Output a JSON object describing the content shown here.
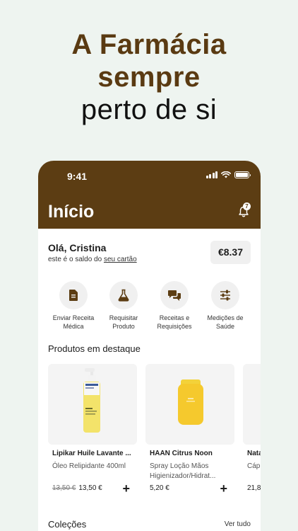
{
  "headline": {
    "line1": "A Farmácia",
    "line2": "sempre",
    "line3": "perto de si"
  },
  "status_bar": {
    "time": "9:41"
  },
  "header": {
    "title": "Início",
    "notification_count": "7"
  },
  "greeting": {
    "hello": "Olá, Cristina",
    "balance_prefix": "este é o saldo do ",
    "balance_link": "seu cartão",
    "balance": "€8.37"
  },
  "actions": [
    {
      "label": "Enviar Receita Médica",
      "icon": "document-icon"
    },
    {
      "label": "Requisitar Produto",
      "icon": "flask-icon"
    },
    {
      "label": "Receitas e Requisições",
      "icon": "chat-icon"
    },
    {
      "label": "Medições de Saúde",
      "icon": "sliders-icon"
    }
  ],
  "featured": {
    "title": "Produtos em destaque",
    "products": [
      {
        "name": "Lipikar Huile Lavante ...",
        "desc": "Óleo Relipidante 400ml",
        "old_price": "13,50 €",
        "price": "13,50 €"
      },
      {
        "name": "HAAN Citrus Noon",
        "desc": "Spray Loção Mãos Higienizador/Hidrat...",
        "old_price": "",
        "price": "5,20 €"
      },
      {
        "name": "Nata",
        "desc": "Cáp",
        "old_price": "",
        "price": "21,8"
      }
    ]
  },
  "collections": {
    "title": "Coleções",
    "see_all": "Ver tudo"
  },
  "colors": {
    "brand": "#5c3d13",
    "background": "#eef4f0"
  }
}
